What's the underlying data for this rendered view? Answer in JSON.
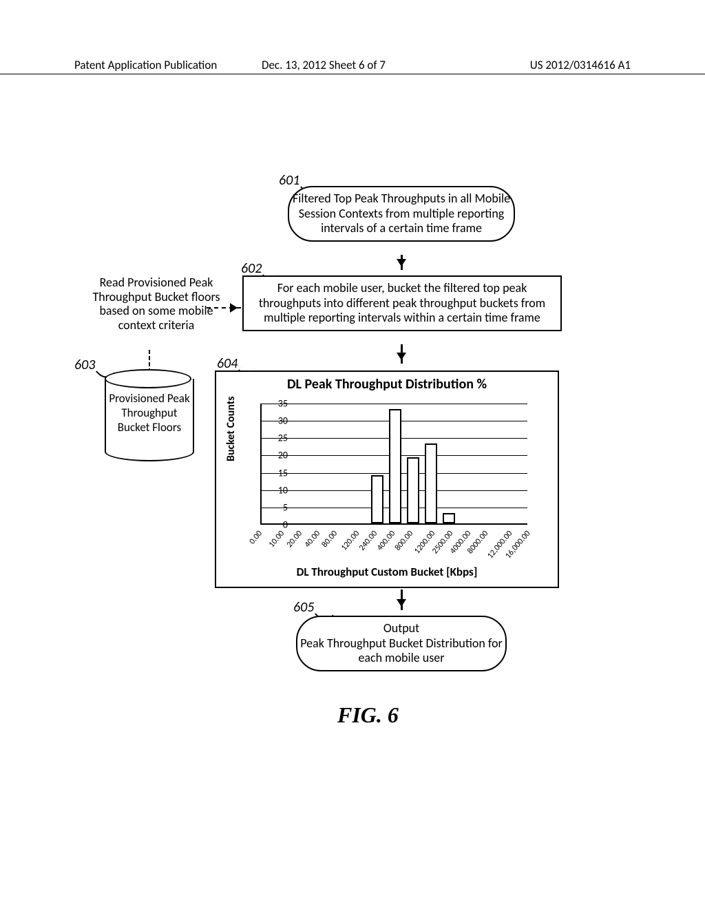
{
  "header": {
    "left": "Patent Application Publication",
    "middle": "Dec. 13, 2012  Sheet 6 of 7",
    "right": "US 2012/0314616 A1"
  },
  "refs": {
    "r601": "601",
    "r602": "602",
    "r603": "603",
    "r604": "604",
    "r605": "605"
  },
  "box601": "Filtered Top Peak Throughputs in all Mobile Session Contexts from multiple reporting intervals of a certain time frame",
  "box602": "For each mobile user, bucket the filtered top peak throughputs into different peak throughput buckets from multiple reporting intervals within a certain time frame",
  "side_text": "Read Provisioned Peak Throughput Bucket floors based on some mobile context criteria",
  "cyl603": "Provisioned Peak Throughput Bucket Floors",
  "box605": "Output\nPeak Throughput Bucket Distribution for each mobile user",
  "fig_caption": "FIG. 6",
  "chart_data": {
    "type": "bar",
    "title": "DL Peak Throughput Distribution %",
    "ylabel": "Bucket Counts",
    "xlabel": "DL Throughput Custom Bucket [Kbps]",
    "ylim": [
      0,
      35
    ],
    "yticks": [
      0,
      5,
      10,
      15,
      20,
      25,
      30,
      35
    ],
    "categories": [
      "0.00",
      "10.00",
      "20.00",
      "40.00",
      "80.00",
      "120.00",
      "240.00",
      "400.00",
      "800.00",
      "1200.00",
      "2500.00",
      "4000.00",
      "8000.00",
      "12,000.00",
      "16,000.00"
    ],
    "values": [
      0,
      0,
      0,
      0,
      0,
      0,
      14,
      33,
      19,
      23,
      3,
      0,
      0,
      0,
      0
    ]
  }
}
